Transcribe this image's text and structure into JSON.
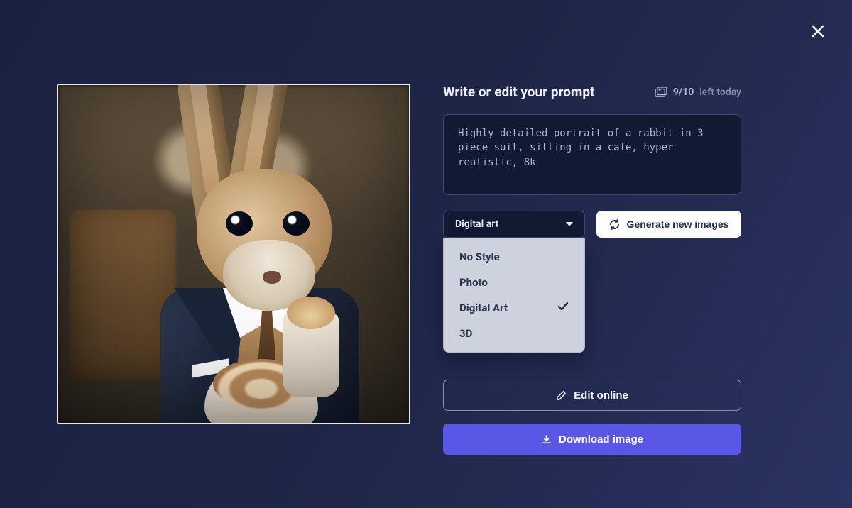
{
  "header": {
    "title": "Write or edit your prompt"
  },
  "credits": {
    "count": "9/10",
    "suffix": "left today"
  },
  "prompt": {
    "value": "Highly detailed portrait of a rabbit in 3 piece suit, sitting in a cafe, hyper realistic, 8k"
  },
  "style": {
    "selected_label": "Digital art",
    "options": [
      {
        "label": "No Style",
        "selected": false
      },
      {
        "label": "Photo",
        "selected": false
      },
      {
        "label": "Digital Art",
        "selected": true
      },
      {
        "label": "3D",
        "selected": false
      }
    ]
  },
  "actions": {
    "generate": "Generate new images",
    "edit": "Edit online",
    "download": "Download image"
  }
}
